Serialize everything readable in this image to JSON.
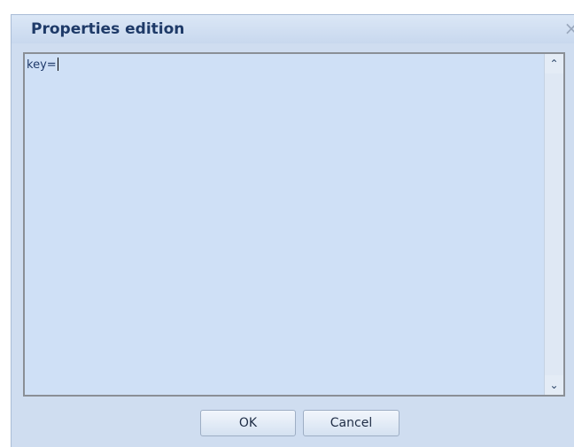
{
  "dialog": {
    "title": "Properties edition",
    "close_symbol": "×"
  },
  "editor": {
    "content": "key="
  },
  "scrollbar": {
    "up_symbol": "⌃",
    "down_symbol": "⌄"
  },
  "buttons": {
    "ok_label": "OK",
    "cancel_label": "Cancel"
  },
  "icons": {
    "close": "close-icon",
    "up": "chevron-up-icon",
    "down": "chevron-down-icon"
  },
  "colors": {
    "dialog_background": "#cfddf0",
    "title_text": "#1e3a68",
    "editor_text": "#1f3a6a"
  }
}
